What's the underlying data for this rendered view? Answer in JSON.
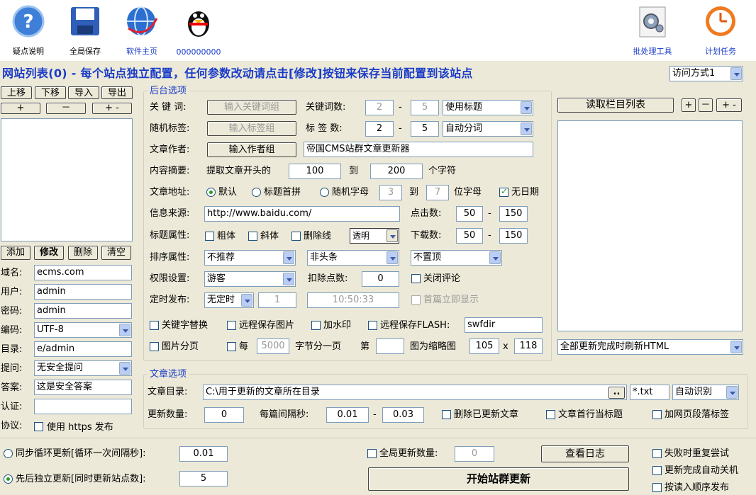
{
  "toolbar": {
    "help": "疑点说明",
    "save_all": "全局保存",
    "homepage": "软件主页",
    "qq": "000000000",
    "batch": "批处理工具",
    "schedule": "计划任务"
  },
  "title": "网站列表(0) - 每个站点独立配置，任何参数改动请点击[修改]按钮来保存当前配置到该站点",
  "access_mode": "访问方式1",
  "left": {
    "up": "上移",
    "down": "下移",
    "import": "导入",
    "export": "导出",
    "plus": "+",
    "minus": "－",
    "plusminus": "+ -",
    "add": "添加",
    "modify": "修改",
    "delete": "删除",
    "clear": "清空",
    "fields": {
      "domain_label": "域名:",
      "domain": "ecms.com",
      "user_label": "用户:",
      "user": "admin",
      "pass_label": "密码:",
      "pass": "admin",
      "enc_label": "编码:",
      "enc": "UTF-8",
      "dir_label": "目录:",
      "dir": "e/admin",
      "q_label": "提问:",
      "q": "无安全提问",
      "a_label": "答案:",
      "a": "这是安全答案",
      "auth_label": "认证:",
      "auth": "",
      "proto_label": "协议:",
      "proto": "使用 https 发布"
    }
  },
  "backend": {
    "legend": "后台选项",
    "keywords_label": "关 键 词:",
    "keywords_btn": "输入关键词组",
    "kwcount_label": "关键词数:",
    "kw_min": "2",
    "kw_max": "5",
    "kw_mode": "使用标题",
    "tags_label": "随机标签:",
    "tags_btn": "输入标签组",
    "tagcount_label": "标 签 数:",
    "tag_min": "2",
    "tag_max": "5",
    "tag_mode": "自动分词",
    "author_label": "文章作者:",
    "author_btn": "输入作者组",
    "author": "帝国CMS站群文章更新器",
    "summary_label": "内容摘要:",
    "summary_pre": "提取文章开头的",
    "sum_min": "100",
    "to": "到",
    "sum_max": "200",
    "summary_post": "个字符",
    "url_label": "文章地址:",
    "url_default": "默认",
    "url_pinyin": "标题首拼",
    "url_random": "随机字母",
    "rnd_min": "3",
    "rnd_max": "7",
    "rnd_post": "位字母",
    "no_date": "无日期",
    "source_label": "信息来源:",
    "source": "http://www.baidu.com/",
    "hits_label": "点击数:",
    "hits_min": "50",
    "hits_max": "150",
    "attr_label": "标题属性:",
    "bold": "粗体",
    "italic": "斜体",
    "strike": "删除线",
    "color": "透明",
    "dl_label": "下载数:",
    "dl_min": "50",
    "dl_max": "150",
    "sort_label": "排序属性:",
    "sort1": "不推荐",
    "sort2": "非头条",
    "sort3": "不置顶",
    "perm_label": "权限设置:",
    "perm": "游客",
    "deduct_label": "扣除点数:",
    "deduct": "0",
    "close_comment": "关闭评论",
    "timer_label": "定时发布:",
    "timer_mode": "无定时",
    "timer_n": "1",
    "timer_time": "10:50:33",
    "first_now": "首篇立即显示",
    "kw_replace": "关键字替换",
    "remote_img": "远程保存图片",
    "watermark": "加水印",
    "remote_flash": "远程保存FLASH:",
    "flash_dir": "swfdir",
    "img_page": "图片分页",
    "every": "每",
    "every_n": "5000",
    "every_post": "字节分一页",
    "nth": "第",
    "nth_n": "",
    "thumb": "图为缩略图",
    "thumb_w": "105",
    "x": "x",
    "thumb_h": "118"
  },
  "right": {
    "read_btn": "读取栏目列表",
    "plus": "+",
    "minus": "－",
    "plusminus": "+ -",
    "refresh": "全部更新完成时刷新HTML"
  },
  "article": {
    "legend": "文章选项",
    "dir_label": "文章目录:",
    "dir": "C:\\用于更新的文章所在目录",
    "browse": "..",
    "ext": "*.txt",
    "detect": "自动识别",
    "count_label": "更新数量:",
    "count": "0",
    "interval_label": "每篇间隔秒:",
    "int_min": "0.01",
    "int_max": "0.03",
    "del_updated": "删除已更新文章",
    "first_line": "文章首行当标题",
    "add_p": "加网页段落标签"
  },
  "bottom": {
    "sync": "同步循环更新[循环一次间隔秒]:",
    "sync_val": "0.01",
    "seq": "先后独立更新[同时更新站点数]:",
    "seq_val": "5",
    "global_count": "全局更新数量:",
    "global_val": "0",
    "log": "查看日志",
    "start": "开始站群更新",
    "retry": "失败时重复尝试",
    "shutdown": "更新完成自动关机",
    "order": "按读入顺序发布"
  },
  "colors": {
    "accent": "#1a3cc8",
    "bg": "#ece9d8",
    "check": "#21a121"
  }
}
